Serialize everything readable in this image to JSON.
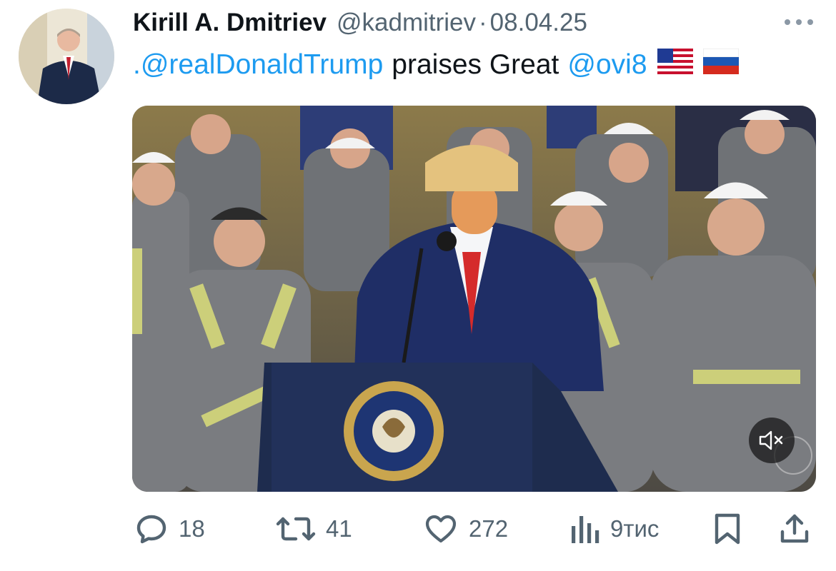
{
  "post": {
    "author_name": "Kirill A. Dmitriev",
    "author_handle": "@kadmitriev",
    "separator": "·",
    "date": "08.04.25",
    "text_mention_1": ".@realDonaldTrump",
    "text_middle": "praises Great",
    "text_mention_2": "@ovi8",
    "flags": [
      "us-flag-emoji",
      "russia-flag-emoji"
    ]
  },
  "media": {
    "type": "video",
    "icon": "muted-speaker-icon",
    "overlay_color": "#141414"
  },
  "actions": {
    "replies": "18",
    "reposts": "41",
    "likes": "272",
    "views": "9тис"
  },
  "colors": {
    "text": "#0f1419",
    "secondary": "#536471",
    "link": "#1d9bf0",
    "background": "#ffffff"
  }
}
